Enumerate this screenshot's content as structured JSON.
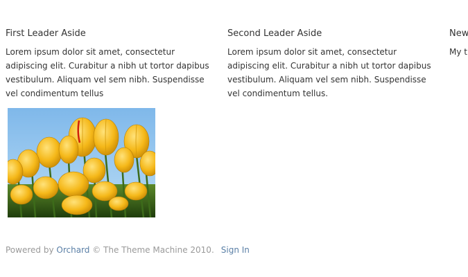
{
  "asides": [
    {
      "title": "First Leader Aside",
      "body": " Lorem ipsum dolor sit amet, consectetur adipiscing elit. Curabitur a nibh ut tortor dapibus vestibulum. Aliquam vel sem nibh. Suspendisse vel condimentum tellus"
    },
    {
      "title": "Second Leader Aside",
      "body": "Lorem ipsum dolor sit amet, consectetur adipiscing elit. Curabitur a nibh ut tortor dapibus vestibulum. Aliquam vel sem nibh. Suspendisse vel condimentum tellus."
    },
    {
      "title": "New",
      "body": "My th"
    }
  ],
  "footer": {
    "powered_by": "Powered by ",
    "orchard_link": "Orchard",
    "copyright": " © The Theme Machine 2010.",
    "sign_in": "Sign In"
  },
  "colors": {
    "text": "#333333",
    "footer_text": "#999999",
    "link": "#5a7fa6"
  }
}
